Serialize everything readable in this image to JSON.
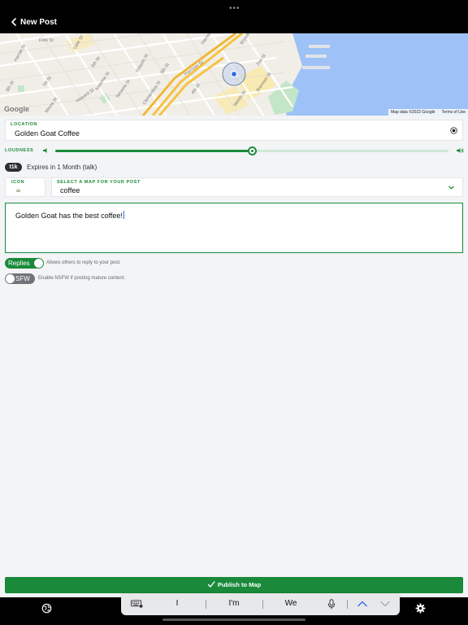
{
  "header": {
    "title": "New Post",
    "back_icon": "chevron-left-icon"
  },
  "map": {
    "attribution": "Map data ©2022 Google",
    "terms": "Terms of Use",
    "logo": "Google",
    "street_labels": [
      "Fork St",
      "Dore St",
      "Harrison St",
      "Folsom St",
      "Bryant St",
      "Brannan St",
      "Townsend St",
      "2nd St",
      "4th St",
      "5th St",
      "6th St",
      "7th St",
      "8th St",
      "Howard St",
      "Minna St",
      "Natoma St",
      "Tehama St",
      "Clementina St",
      "Harriet St",
      "Welsh St"
    ]
  },
  "location": {
    "label": "LOCATION",
    "value": "Golden Goat Coffee",
    "clear_icon": "clear-circle-icon"
  },
  "loudness": {
    "label": "LOUDNESS",
    "value_fraction": 0.5,
    "low_icon": "speaker-low-icon",
    "high_icon": "speaker-high-icon"
  },
  "expiry": {
    "tag": "t1k",
    "text": "Expires in 1 Month (talk)"
  },
  "icon_field": {
    "label": "ICON",
    "value": "☕"
  },
  "map_select": {
    "label": "SELECT A MAP FOR YOUR POST",
    "value": "coffee",
    "chevron_icon": "chevron-down-icon"
  },
  "message": {
    "text": "Golden Goat has the best coffee!"
  },
  "replies": {
    "label": "Replies",
    "on": true,
    "description": "Allows others to reply to your post."
  },
  "sfw": {
    "label": "SFW",
    "on": false,
    "description": "Enable NSFW if posting mature content."
  },
  "publish": {
    "label": "Publish to Map",
    "icon": "checkmark-icon"
  },
  "keyboard_bar": {
    "suggestions": [
      "I",
      "I'm",
      "We"
    ]
  },
  "colors": {
    "accent": "#1a8a3a",
    "water": "#9ec2f7",
    "park": "#c3e6c8",
    "highway": "#f7c241"
  }
}
